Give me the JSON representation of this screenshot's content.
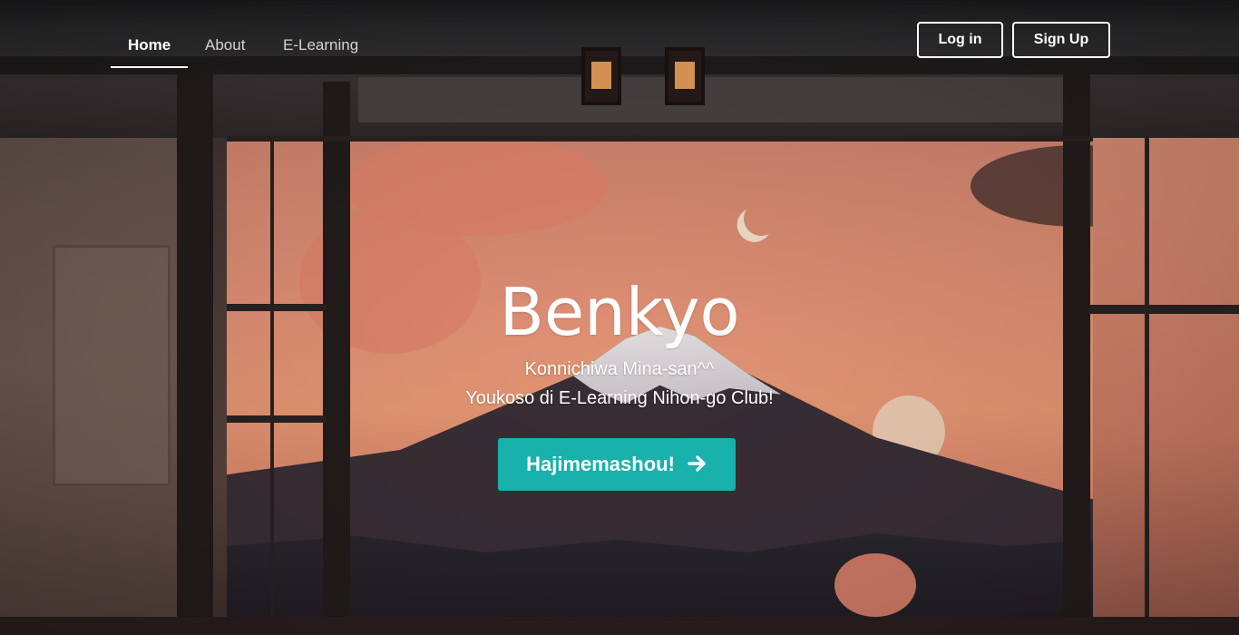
{
  "nav": {
    "links": [
      {
        "label": "Home",
        "active": true
      },
      {
        "label": "About",
        "active": false
      },
      {
        "label": "E-Learning",
        "active": false
      }
    ],
    "login_label": "Log in",
    "signup_label": "Sign Up"
  },
  "hero": {
    "title": "Benkyo",
    "line1": "Konnichiwa Mina-san^^",
    "line2": "Youkoso di E-Learning Nihon-go Club!",
    "cta_label": "Hajimemashou!",
    "cta_icon": "arrow-right-icon"
  },
  "colors": {
    "accent": "#19b1ab",
    "text": "#ffffff"
  }
}
